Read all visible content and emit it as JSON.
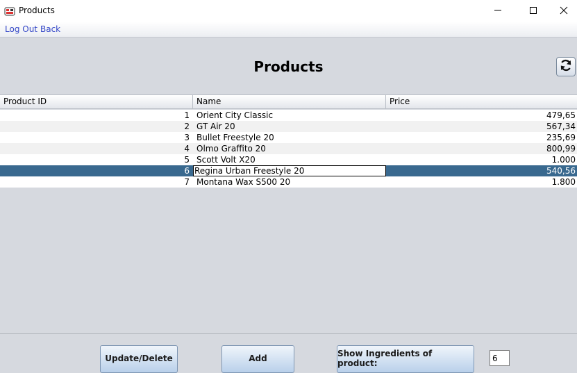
{
  "window": {
    "title": "Products"
  },
  "menu": {
    "logout": "Log Out",
    "back": "Back"
  },
  "page": {
    "title": "Products"
  },
  "table": {
    "columns": [
      "Product ID",
      "Name",
      "Price"
    ],
    "rows": [
      {
        "id": "1",
        "name": "Orient City Classic",
        "price": "479,65"
      },
      {
        "id": "2",
        "name": "GT Air 20",
        "price": "567,34"
      },
      {
        "id": "3",
        "name": "Bullet Freestyle 20",
        "price": "235,69"
      },
      {
        "id": "4",
        "name": "Olmo Graffito 20",
        "price": "800,99"
      },
      {
        "id": "5",
        "name": "Scott Volt X20",
        "price": "1.000"
      },
      {
        "id": "6",
        "name": "Regina Urban Freestyle 20",
        "price": "540,56"
      },
      {
        "id": "7",
        "name": "Montana Wax S500 20",
        "price": "1.800"
      }
    ],
    "selected_row": 5,
    "selection_color": "#39698f"
  },
  "buttons": {
    "update_delete": "Update/Delete",
    "add": "Add",
    "show_ingredients": "Show Ingredients of product:"
  },
  "product_input": {
    "value": "6"
  },
  "icons": {
    "refresh": "refresh-icon",
    "app": "app-icon",
    "minimize": "minimize-icon",
    "maximize": "maximize-icon",
    "close": "close-icon"
  }
}
